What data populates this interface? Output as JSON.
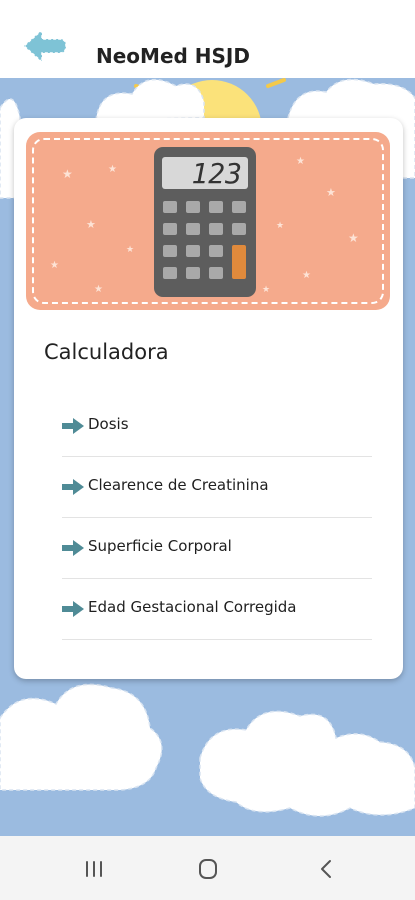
{
  "header": {
    "title": "NeoMed HSJD",
    "back_icon": "back-arrow-icon"
  },
  "card": {
    "banner_icon": "calculator-icon",
    "calculator_display": "123",
    "title": "Calculadora",
    "items": [
      {
        "label": "Dosis",
        "icon": "arrow-right-icon"
      },
      {
        "label": "Clearence de Creatinina",
        "icon": "arrow-right-icon"
      },
      {
        "label": "Superficie Corporal",
        "icon": "arrow-right-icon"
      },
      {
        "label": "Edad Gestacional Corregida",
        "icon": "arrow-right-icon"
      }
    ]
  },
  "navbar": {
    "recents_icon": "recent-apps-icon",
    "home_icon": "home-icon",
    "back_icon": "back-chevron-icon"
  },
  "colors": {
    "sky": "#9bbbe0",
    "banner": "#f5aa8c",
    "accent_arrow": "#4f8b96",
    "back_button": "#7ec3d6",
    "calculator_body": "#5d5d5d",
    "calculator_key_accent": "#e08a3c"
  }
}
